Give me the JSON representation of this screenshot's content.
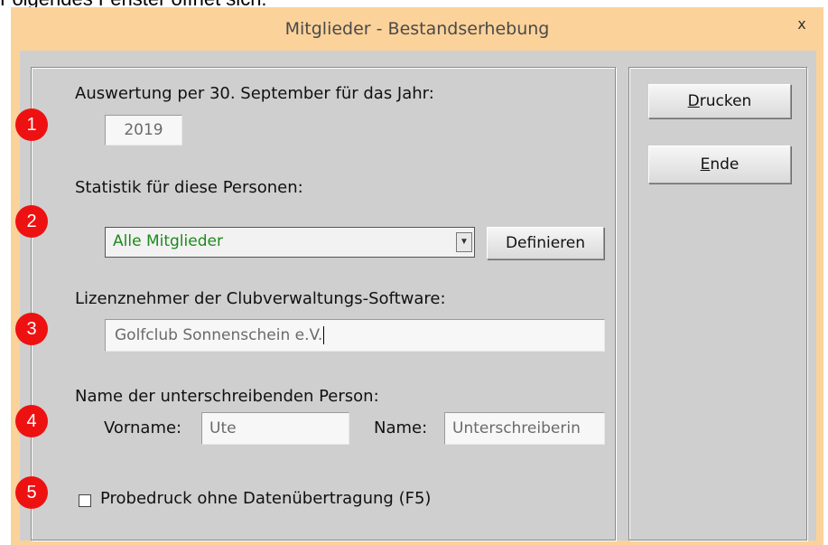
{
  "document": {
    "intro_text": "Folgendes Fenster öffnet sich:"
  },
  "window": {
    "title": "Mitglieder - Bestandserhebung",
    "close_label": "x"
  },
  "year_section": {
    "label": "Auswertung per 30. September für das Jahr:",
    "value": "2019"
  },
  "persons_section": {
    "label": "Statistik für diese Personen:",
    "selected": "Alle Mitglieder",
    "define_button": "Definieren"
  },
  "licensee_section": {
    "label": "Lizenznehmer der Clubverwaltungs-Software:",
    "value": "Golfclub Sonnenschein e.V."
  },
  "signer_section": {
    "label": "Name der unterschreibenden Person:",
    "firstname_label": "Vorname:",
    "firstname_value": "Ute",
    "lastname_label": "Name:",
    "lastname_value": "Unterschreiberin"
  },
  "test_print": {
    "label": "Probedruck ohne Datenübertragung (F5)",
    "checked": false
  },
  "buttons": {
    "print": {
      "accel": "D",
      "rest": "rucken"
    },
    "end": {
      "accel": "E",
      "rest": "nde"
    }
  },
  "badges": [
    "1",
    "2",
    "3",
    "4",
    "5"
  ],
  "colors": {
    "badge": "#ee1111",
    "combo_text": "#1c8a1c",
    "frame": "#fbd29a",
    "client": "#cfcfcf"
  }
}
